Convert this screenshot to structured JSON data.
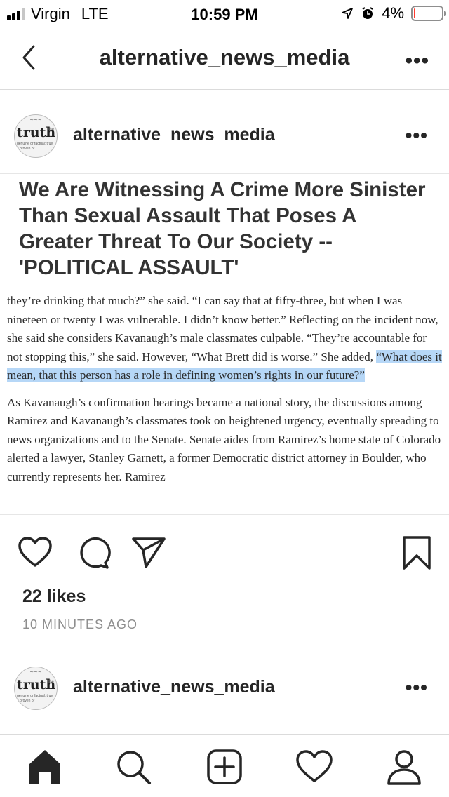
{
  "status_bar": {
    "carrier": "Virgin",
    "network": "LTE",
    "time": "10:59 PM",
    "battery_percent": "4%",
    "battery_level": 0.04,
    "battery_color": "#ff3b30"
  },
  "nav": {
    "title": "alternative_news_media",
    "back_icon": "chevron-left-icon",
    "more_icon": "more-horizontal-icon",
    "more_label": "•••"
  },
  "post": {
    "username": "alternative_news_media",
    "avatar_logo": "truth",
    "avatar_subtext": "genuine or factual; true a proven or",
    "more_label": "•••",
    "headline": "We Are Witnessing A Crime More Sinister Than Sexual Assault That Poses A Greater Threat To Our Society -- 'POLITICAL ASSAULT'",
    "paragraph1_pre": "they’re drinking that much?” she said. “I can say that at fifty-three, but when I was nineteen or twenty I was vulnerable. I didn’t know better.” Reflecting on the incident now, she said she considers Kavanaugh’s male classmates culpable. “They’re accountable for not stopping this,” she said. However, “What Brett did is worse.” She added, ",
    "paragraph1_highlight": "“What does it mean, that this person has a role in defining women’s rights in our future?”",
    "paragraph2": "As Kavanaugh’s confirmation hearings became a national story, the discussions among Ramirez and Kavanaugh’s classmates took on heightened urgency, eventually spreading to news organizations and to the Senate. Senate aides from Ramirez’s home state of Colorado alerted a lawyer, Stanley Garnett, a former Democratic district attorney in Boulder, who currently represents her. Ramirez",
    "highlight_color": "#b6d7f7",
    "likes": "22 likes",
    "time_ago": "10 MINUTES AGO"
  },
  "next_post": {
    "username": "alternative_news_media",
    "avatar_logo": "truth",
    "avatar_subtext": "genuine or factual; true a proven or",
    "more_label": "•••"
  },
  "actions": [
    "heart-icon",
    "comment-icon",
    "send-icon",
    "bookmark-icon"
  ],
  "tabbar": [
    "home-icon",
    "search-icon",
    "add-post-icon",
    "activity-heart-icon",
    "profile-icon"
  ]
}
